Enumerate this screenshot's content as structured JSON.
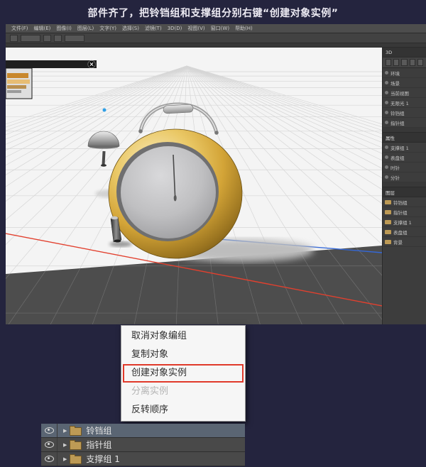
{
  "caption": "部件齐了，把铃铛组和支撑组分别右键“创建对象实例”",
  "menubar": {
    "items": [
      "文件(F)",
      "编辑(E)",
      "图像(I)",
      "图层(L)",
      "文字(Y)",
      "选择(S)",
      "滤镜(T)",
      "3D(D)",
      "视图(V)",
      "窗口(W)",
      "帮助(H)"
    ]
  },
  "right_panel": {
    "panel_a_title": "3D",
    "panel_a_rows": [
      "环境",
      "场景",
      "当前视图",
      "无限光 1",
      "铃铛组",
      "指针组"
    ],
    "panel_b_title": "属性",
    "panel_b_rows": [
      "支撑组 1",
      "表盘组",
      "时针",
      "分针"
    ],
    "panel_c_title": "图层",
    "panel_c_rows": [
      "铃铛组",
      "指针组",
      "支撑组 1",
      "表盘组",
      "背景"
    ]
  },
  "context_menu": {
    "items": [
      {
        "label": "取消对象编组"
      },
      {
        "label": "复制对象"
      },
      {
        "label": "创建对象实例",
        "boxed": true
      },
      {
        "label": "分离实例",
        "disabled": true
      },
      {
        "label": "反转顺序"
      }
    ]
  },
  "layers": [
    {
      "name": "铃铛组",
      "selected": true
    },
    {
      "name": "指针组"
    },
    {
      "name": "支撑组 1"
    }
  ],
  "icons": {
    "expand": "▶"
  },
  "colors": {
    "annotation_red": "#e03a2a",
    "axis_red": "#e2402e",
    "axis_blue": "#3468d8",
    "clock_gold": "#d3a437",
    "background_navy": "#24243e"
  }
}
